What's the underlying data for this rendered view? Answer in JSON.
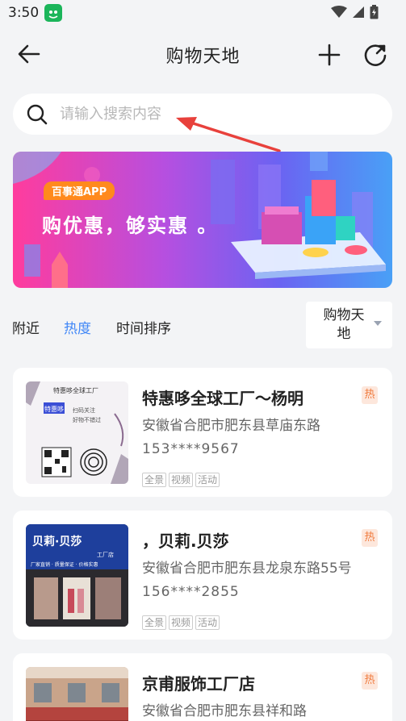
{
  "status_bar": {
    "time": "3:50"
  },
  "nav": {
    "title": "购物天地"
  },
  "search": {
    "placeholder": "请输入搜索内容"
  },
  "banner": {
    "badge": "百事通APP",
    "slogan": "购优惠，够实惠 。"
  },
  "filters": {
    "tabs": [
      "附近",
      "热度",
      "时间排序"
    ],
    "active_tab": "热度",
    "category": "购物天地"
  },
  "shops": [
    {
      "name": "特惠哆全球工厂～杨明",
      "address": "安徽省合肥市肥东县草庙东路",
      "phone": "153****9567",
      "tags": [
        "全景",
        "视频",
        "活动"
      ],
      "hot": "热"
    },
    {
      "name": "，贝莉.贝莎",
      "address": "安徽省合肥市肥东县龙泉东路55号",
      "phone": "156****2855",
      "tags": [
        "全景",
        "视频",
        "活动"
      ],
      "hot": "热"
    },
    {
      "name": "京甫服饰工厂店",
      "address": "安徽省合肥市肥东县祥和路",
      "hot": "热"
    }
  ],
  "thumbs": {
    "shop1_header": "特惠哆全球工厂",
    "shop1_logo": "特惠哆",
    "shop1_lines": [
      "扫码关注",
      "好物不错过"
    ],
    "shop2_sign": "贝莉·贝莎",
    "shop2_sub": "工厂店",
    "shop2_row": "厂家直销 · 质量保证 · 价格实惠"
  },
  "colors": {
    "accent": "#3f86f7",
    "hot_bg": "#fde7dc",
    "hot_text": "#f07a3c",
    "arrow": "#e8413c",
    "app_icon": "#1bb55a"
  }
}
